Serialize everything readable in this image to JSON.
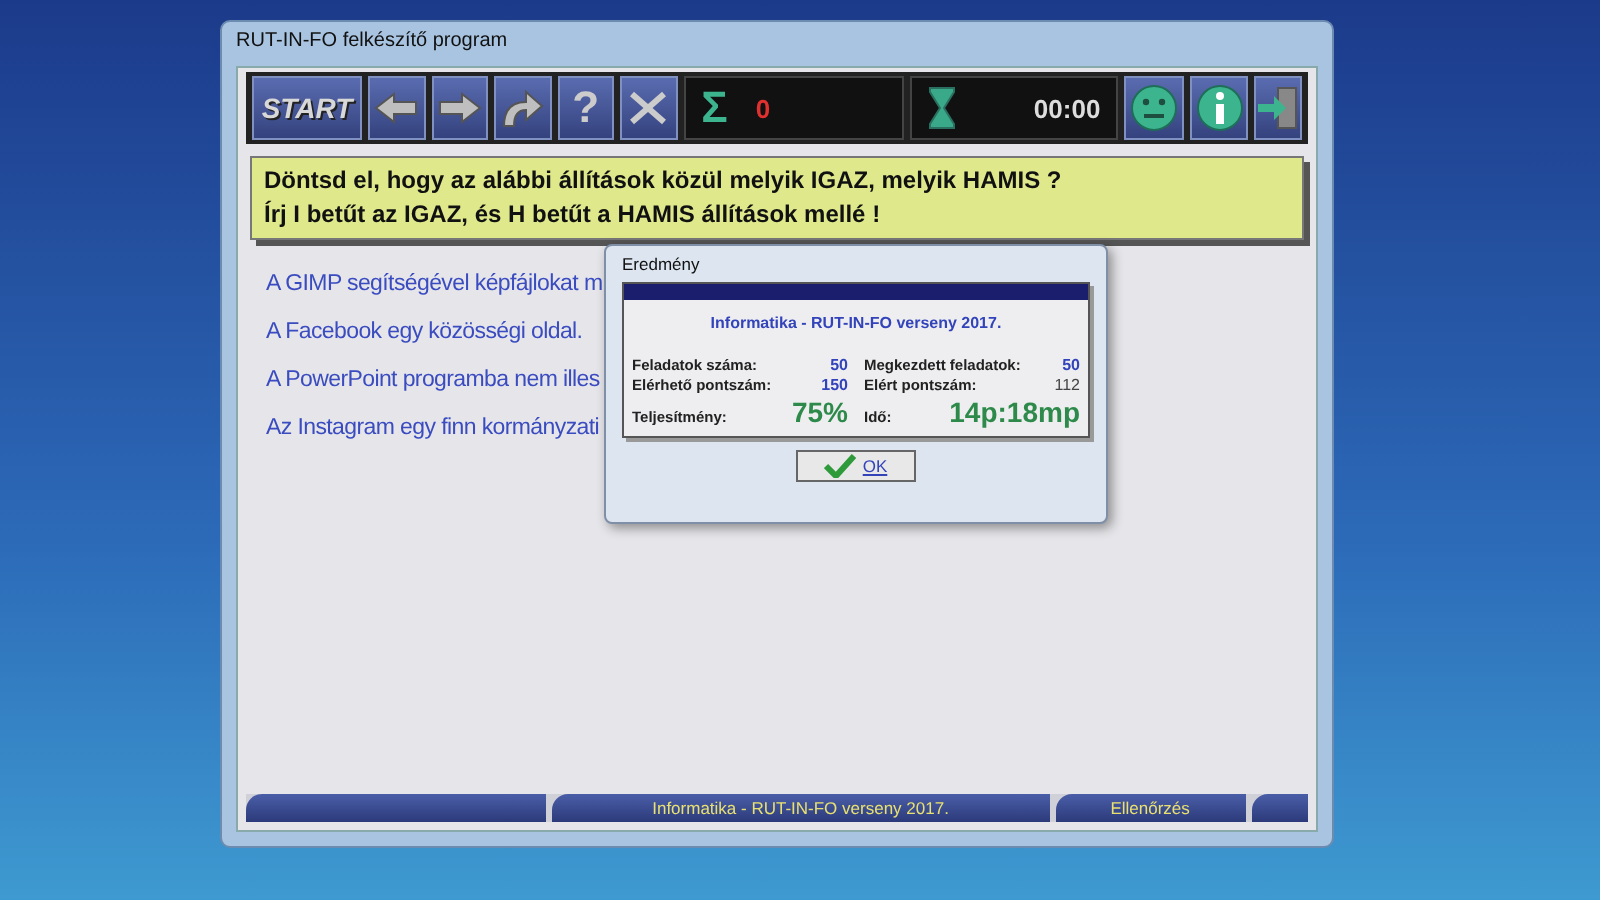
{
  "window": {
    "title": "RUT-IN-FO felkészítő program"
  },
  "toolbar": {
    "start_label": "START",
    "help_label": "?",
    "score_symbol": "Σ",
    "score": "0",
    "timer": "00:00"
  },
  "question": {
    "lines": [
      "Döntsd el, hogy az alábbi állítások közül melyik IGAZ, melyik HAMIS ?",
      "Írj I betűt az IGAZ, és H betűt a HAMIS állítások mellé !"
    ]
  },
  "statements": [
    "A GIMP segítségével képfájlokat m",
    "A Facebook egy közösségi oldal.",
    "A PowerPoint programba nem illes",
    "Az Instagram egy finn kormányzati"
  ],
  "dialog": {
    "title": "Eredmény",
    "headline": "Informatika - RUT-IN-FO verseny 2017.",
    "stats": [
      {
        "label": "Feladatok száma:",
        "value": "50",
        "kind": "count"
      },
      {
        "label": "Megkezdett feladatok:",
        "value": "50",
        "kind": "count"
      },
      {
        "label": "Elérhető pontszám:",
        "value": "150",
        "kind": "count"
      },
      {
        "label": "Elért pontszám:",
        "value": "112",
        "kind": "score"
      },
      {
        "label": "Teljesítmény:",
        "value": "75%",
        "kind": "big"
      },
      {
        "label": "Idő:",
        "value": "14p:18mp",
        "kind": "big"
      }
    ],
    "ok_button": "OK"
  },
  "footer": {
    "caption": "Informatika - RUT-IN-FO verseny 2017.",
    "action": "Ellenőrzés"
  }
}
